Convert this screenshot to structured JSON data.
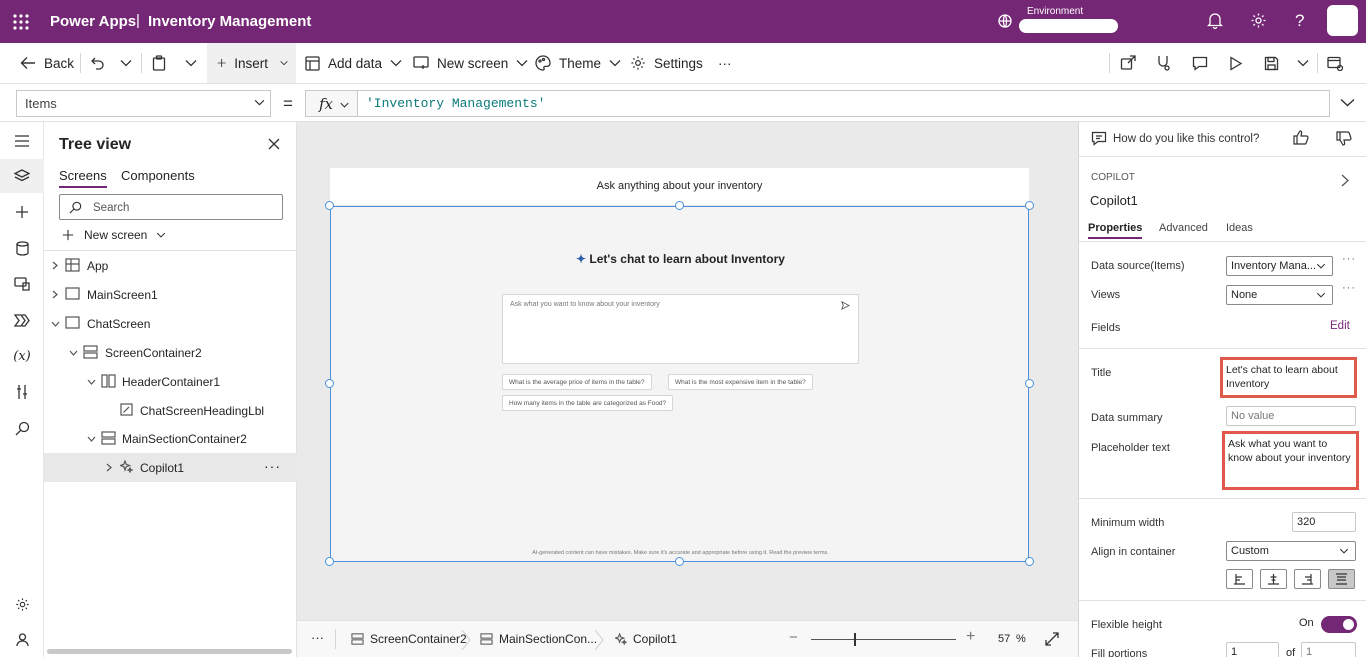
{
  "app": {
    "brand": "Power Apps",
    "separator": "|",
    "title": "Inventory Management",
    "environment_label": "Environment"
  },
  "toolbar": {
    "back": "Back",
    "insert": "Insert",
    "add_data": "Add data",
    "new_screen": "New screen",
    "theme": "Theme",
    "settings": "Settings",
    "more": "···"
  },
  "formula": {
    "property": "Items",
    "equals": "=",
    "fx": "fx",
    "expression": "'Inventory Managements'"
  },
  "tree": {
    "title": "Tree view",
    "tabs": [
      "Screens",
      "Components"
    ],
    "search_placeholder": "Search",
    "new_screen": "New screen",
    "nodes": [
      "App",
      "MainScreen1",
      "ChatScreen",
      "ScreenContainer2",
      "HeaderContainer1",
      "ChatScreenHeadingLbl",
      "MainSectionContainer2",
      "Copilot1"
    ],
    "more": "···"
  },
  "canvas": {
    "header_text": "Ask anything about your inventory",
    "chat_title": "Let's chat to learn about Inventory",
    "input_placeholder": "Ask what you want to know about your inventory",
    "suggestions": [
      "What is the average price of items in the table?",
      "What is the most expensive item in the table?",
      "How many items in the table are categorized as Food?"
    ],
    "disclaimer": "AI-generated content can have mistakes. Make sure it's accurate and appropriate before using it. Read the preview terms."
  },
  "statusbar": {
    "more": "···",
    "crumbs": [
      "ScreenContainer2",
      "MainSectionCon...",
      "Copilot1"
    ],
    "zoom_minus": "−",
    "zoom_plus": "+",
    "zoom_value": "57",
    "zoom_unit": "%"
  },
  "properties": {
    "feedback_question": "How do you like this control?",
    "control_type": "COPILOT",
    "control_name": "Copilot1",
    "tabs": [
      "Properties",
      "Advanced",
      "Ideas"
    ],
    "data_source_label": "Data source(Items)",
    "data_source_value": "Inventory Mana...",
    "views_label": "Views",
    "views_value": "None",
    "fields_label": "Fields",
    "fields_edit": "Edit",
    "title_label": "Title",
    "title_value": "Let's chat to learn about Inventory",
    "data_summary_label": "Data summary",
    "data_summary_placeholder": "No value",
    "placeholder_label": "Placeholder text",
    "placeholder_value": "Ask what you want to know about your inventory",
    "min_width_label": "Minimum width",
    "min_width_value": "320",
    "align_label": "Align in container",
    "align_value": "Custom",
    "flex_height_label": "Flexible height",
    "flex_height_state": "On",
    "fill_portions_label": "Fill portions",
    "fill_portions_value": "1",
    "fill_portions_of": "of",
    "fill_portions_total": "1",
    "more": "···"
  },
  "colors": {
    "brand": "#742774",
    "highlight": "#e05a4b",
    "selection": "#4a90d9"
  }
}
